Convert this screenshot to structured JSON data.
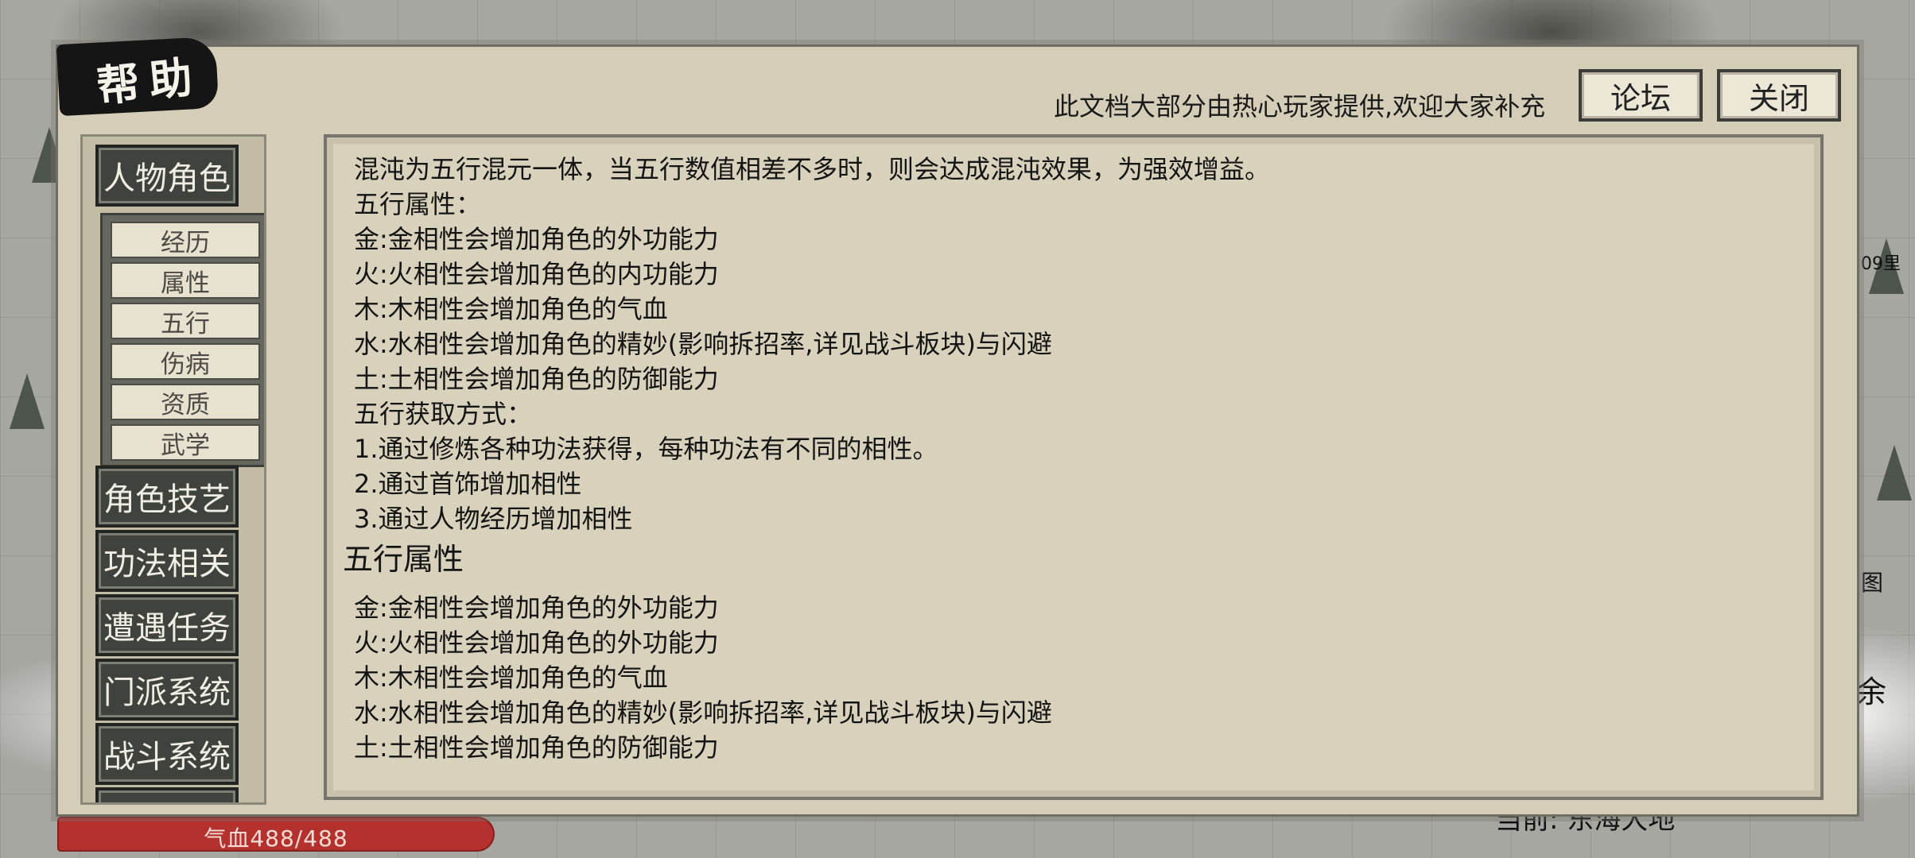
{
  "dialog": {
    "title": "帮助",
    "notice": "此文档大部分由热心玩家提供,欢迎大家补充",
    "forum_label": "论坛",
    "close_label": "关闭"
  },
  "sidebar": {
    "categories": [
      {
        "label": "人物角色"
      },
      {
        "label": "角色技艺"
      },
      {
        "label": "功法相关"
      },
      {
        "label": "遭遇任务"
      },
      {
        "label": "门派系统"
      },
      {
        "label": "战斗系统"
      }
    ],
    "subitems": [
      {
        "label": "经历"
      },
      {
        "label": "属性"
      },
      {
        "label": "五行"
      },
      {
        "label": "伤病"
      },
      {
        "label": "资质"
      },
      {
        "label": "武学"
      }
    ]
  },
  "content": {
    "intro_lines": [
      "混沌为五行混元一体，当五行数值相差不多时，则会达成混沌效果，为强效增益。",
      "五行属性：",
      "金:金相性会增加角色的外功能力",
      "火:火相性会增加角色的内功能力",
      "木:木相性会增加角色的气血",
      "水:水相性会增加角色的精妙(影响拆招率,详见战斗板块)与闪避",
      "土:土相性会增加角色的防御能力",
      "五行获取方式：",
      "1.通过修炼各种功法获得，每种功法有不同的相性。",
      "2.通过首饰增加相性",
      "3.通过人物经历增加相性"
    ],
    "section_heading": "五行属性",
    "section_lines": [
      "金:金相性会增加角色的外功能力",
      "火:火相性会增加角色的外功能力",
      "木:木相性会增加角色的气血",
      "水:水相性会增加角色的精妙(影响拆招率,详见战斗板块)与闪避",
      "土:土相性会增加角色的防御能力"
    ]
  },
  "hud": {
    "hp_text": "气血488/488",
    "location_text": "当前: 东海大地",
    "right_distance": "09里",
    "right_map_label": "图",
    "right_glyph": "余"
  }
}
